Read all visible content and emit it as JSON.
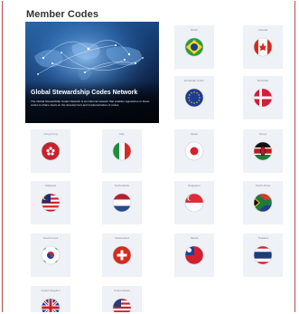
{
  "page_title": "Member Codes",
  "hero": {
    "title": "Global Stewardship Codes Network",
    "description": "The Global Stewardship Codes Network is an informal network that enables signatories to these codes to share views on the development and implementation of codes."
  },
  "members": [
    {
      "name": "Brazil",
      "flag": "brazil-flag-icon"
    },
    {
      "name": "Canada",
      "flag": "canada-flag-icon"
    },
    {
      "name": "European Union",
      "flag": "eu-flag-icon"
    },
    {
      "name": "Denmark",
      "flag": "denmark-flag-icon"
    },
    {
      "name": "Hong Kong",
      "flag": "hong-kong-flag-icon"
    },
    {
      "name": "Italy",
      "flag": "italy-flag-icon"
    },
    {
      "name": "Japan",
      "flag": "japan-flag-icon"
    },
    {
      "name": "Kenya",
      "flag": "kenya-flag-icon"
    },
    {
      "name": "Malaysia",
      "flag": "malaysia-flag-icon"
    },
    {
      "name": "Netherlands",
      "flag": "netherlands-flag-icon"
    },
    {
      "name": "Singapore",
      "flag": "singapore-flag-icon"
    },
    {
      "name": "South Africa",
      "flag": "south-africa-flag-icon"
    },
    {
      "name": "South Korea",
      "flag": "south-korea-flag-icon"
    },
    {
      "name": "Switzerland",
      "flag": "switzerland-flag-icon"
    },
    {
      "name": "Taiwan",
      "flag": "taiwan-flag-icon"
    },
    {
      "name": "Thailand",
      "flag": "thailand-flag-icon"
    },
    {
      "name": "United Kingdom",
      "flag": "uk-flag-icon"
    },
    {
      "name": "United States",
      "flag": "usa-flag-icon"
    }
  ],
  "colors": {
    "frame_border": "#b44a4a",
    "tile_bg": "#eef1f5"
  }
}
